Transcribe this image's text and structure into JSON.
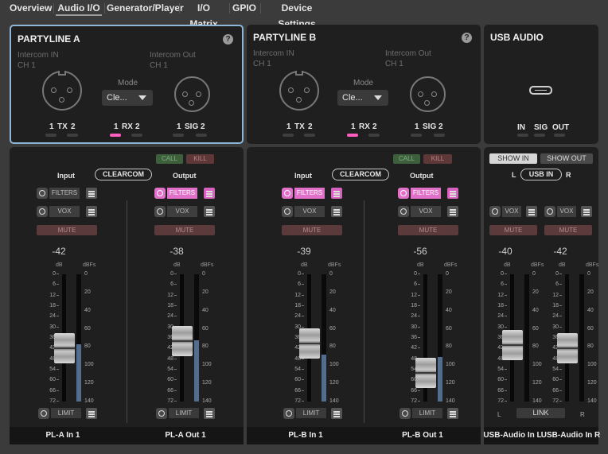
{
  "tabs": [
    "Overview",
    "Audio I/O",
    "Generator/Player",
    "I/O Matrix",
    "GPIO",
    "Device Settings"
  ],
  "active_tab": "Audio I/O",
  "partyline_a": {
    "title": "PARTYLINE A",
    "in_label": "Intercom IN",
    "in_ch": "CH 1",
    "out_label": "Intercom Out",
    "out_ch": "CH 1",
    "mode_label": "Mode",
    "mode_value": "Cle...",
    "tx": [
      "1",
      "TX",
      "2"
    ],
    "rx": [
      "1",
      "RX",
      "2"
    ],
    "sig": [
      "1",
      "SIG",
      "2"
    ]
  },
  "partyline_b": {
    "title": "PARTYLINE B",
    "in_label": "Intercom IN",
    "in_ch": "CH 1",
    "out_label": "Intercom Out",
    "out_ch": "CH 1",
    "mode_label": "Mode",
    "mode_value": "Cle...",
    "tx": [
      "1",
      "TX",
      "2"
    ],
    "rx": [
      "1",
      "RX",
      "2"
    ],
    "sig": [
      "1",
      "SIG",
      "2"
    ]
  },
  "usb_audio": {
    "title": "USB AUDIO",
    "in": "IN",
    "sig": "SIG",
    "out": "OUT"
  },
  "strip_common": {
    "call": "CALL",
    "kill": "KILL",
    "input": "Input",
    "output": "Output",
    "clearcom": "CLEARCOM",
    "filters": "FILTERS",
    "vox": "VOX",
    "mute": "MUTE",
    "limit": "LIMIT",
    "db": "dB",
    "dbfs": "dBFs",
    "db_ticks": [
      "0",
      "6",
      "12",
      "18",
      "24",
      "30",
      "36",
      "42",
      "48",
      "54",
      "60",
      "66",
      "72"
    ],
    "dbfs_ticks": [
      "0",
      "20",
      "40",
      "60",
      "80",
      "100",
      "120",
      "140"
    ]
  },
  "usb_strip": {
    "show_in": "SHOW IN",
    "show_out": "SHOW OUT",
    "l": "L",
    "usb_in": "USB IN",
    "r": "R",
    "link": "LINK"
  },
  "channels": [
    {
      "name": "PL-A In 1",
      "gain": "-42",
      "fader_db": -42,
      "meter_fraction": 0.45
    },
    {
      "name": "PL-A Out 1",
      "gain": "-38",
      "fader_db": -38,
      "meter_fraction": 0.48
    },
    {
      "name": "PL-B In 1",
      "gain": "-39",
      "fader_db": -39,
      "meter_fraction": 0.37
    },
    {
      "name": "PL-B Out 1",
      "gain": "-56",
      "fader_db": -56,
      "meter_fraction": 0.35
    },
    {
      "name": "USB-Audio In L",
      "gain": "-40",
      "fader_db": -40,
      "meter_fraction": 0
    },
    {
      "name": "USB-Audio In R",
      "gain": "-42",
      "fader_db": -42,
      "meter_fraction": 0
    }
  ],
  "colors": {
    "accent_pink": "#e070c8",
    "selected_border": "#8eb6d8",
    "meter_fill": "#526d8e"
  },
  "icons": {
    "help": "help-icon",
    "power": "power-icon",
    "eq": "eq-settings-icon",
    "usb": "usb-c-icon",
    "xlr": "xlr-connector-icon"
  }
}
